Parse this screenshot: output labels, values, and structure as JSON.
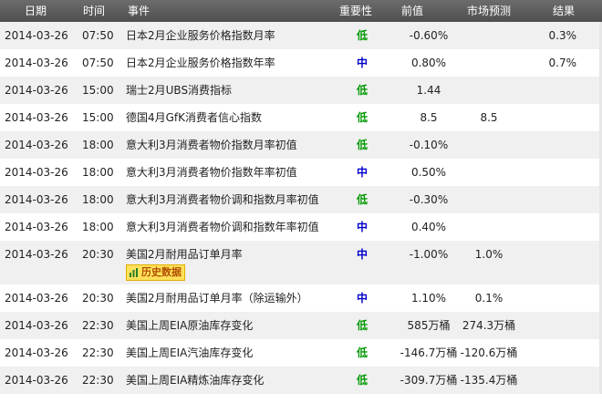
{
  "header": {
    "date": "日期",
    "time": "时间",
    "event": "事件",
    "importance": "重要性",
    "previous": "前值",
    "forecast": "市场预测",
    "actual": "结果"
  },
  "colors": {
    "low": "#009900",
    "medium": "#0000cc",
    "header_bg": "#5d5d5d",
    "alt_row_bg": "#f0f0f0"
  },
  "history_button": {
    "label": "历史数据",
    "icon": "bar-chart-icon"
  },
  "rows": [
    {
      "date": "2014-03-26",
      "time": "07:50",
      "event": "日本2月企业服务价格指数月率",
      "importance": "低",
      "level": "low",
      "previous": "-0.60%",
      "forecast": "",
      "actual": "0.3%"
    },
    {
      "date": "2014-03-26",
      "time": "07:50",
      "event": "日本2月企业服务价格指数年率",
      "importance": "中",
      "level": "medium",
      "previous": "0.80%",
      "forecast": "",
      "actual": "0.7%"
    },
    {
      "date": "2014-03-26",
      "time": "15:00",
      "event": "瑞士2月UBS消费指标",
      "importance": "低",
      "level": "low",
      "previous": "1.44",
      "forecast": "",
      "actual": ""
    },
    {
      "date": "2014-03-26",
      "time": "15:00",
      "event": "德国4月GfK消费者信心指数",
      "importance": "低",
      "level": "low",
      "previous": "8.5",
      "forecast": "8.5",
      "actual": ""
    },
    {
      "date": "2014-03-26",
      "time": "18:00",
      "event": "意大利3月消费者物价指数月率初值",
      "importance": "低",
      "level": "low",
      "previous": "-0.10%",
      "forecast": "",
      "actual": ""
    },
    {
      "date": "2014-03-26",
      "time": "18:00",
      "event": "意大利3月消费者物价指数年率初值",
      "importance": "中",
      "level": "medium",
      "previous": "0.50%",
      "forecast": "",
      "actual": ""
    },
    {
      "date": "2014-03-26",
      "time": "18:00",
      "event": "意大利3月消费者物价调和指数月率初值",
      "importance": "低",
      "level": "low",
      "previous": "-0.30%",
      "forecast": "",
      "actual": ""
    },
    {
      "date": "2014-03-26",
      "time": "18:00",
      "event": "意大利3月消费者物价调和指数年率初值",
      "importance": "中",
      "level": "medium",
      "previous": "0.40%",
      "forecast": "",
      "actual": ""
    },
    {
      "date": "2014-03-26",
      "time": "20:30",
      "event": "美国2月耐用品订单月率",
      "importance": "中",
      "level": "medium",
      "previous": "-1.00%",
      "forecast": "1.0%",
      "actual": "",
      "history": true
    },
    {
      "date": "2014-03-26",
      "time": "20:30",
      "event": "美国2月耐用品订单月率（除运输外）",
      "importance": "中",
      "level": "medium",
      "previous": "1.10%",
      "forecast": "0.1%",
      "actual": ""
    },
    {
      "date": "2014-03-26",
      "time": "22:30",
      "event": "美国上周EIA原油库存变化",
      "importance": "低",
      "level": "low",
      "previous": "585万桶",
      "forecast": "274.3万桶",
      "actual": ""
    },
    {
      "date": "2014-03-26",
      "time": "22:30",
      "event": "美国上周EIA汽油库存变化",
      "importance": "低",
      "level": "low",
      "previous": "-146.7万桶",
      "forecast": "-120.6万桶",
      "actual": ""
    },
    {
      "date": "2014-03-26",
      "time": "22:30",
      "event": "美国上周EIA精炼油库存变化",
      "importance": "低",
      "level": "low",
      "previous": "-309.7万桶",
      "forecast": "-135.4万桶",
      "actual": ""
    }
  ]
}
